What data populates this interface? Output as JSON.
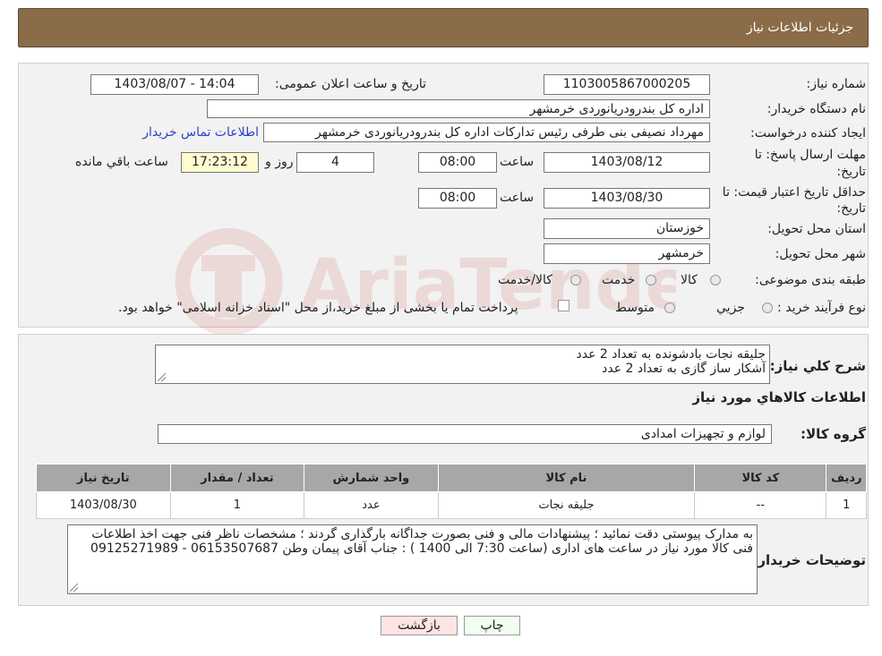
{
  "header": {
    "title": "جزئیات اطلاعات نیاز"
  },
  "form": {
    "need_number_label": "شماره نیاز:",
    "need_number": "1103005867000205",
    "announce_label": "تاریخ و ساعت اعلان عمومی:",
    "announce_value": "1403/08/07 - 14:04",
    "buyer_org_label": "نام دستگاه خریدار:",
    "buyer_org": "اداره کل بندرودریانوردی خرمشهر",
    "creator_label": "ایجاد کننده درخواست:",
    "creator": "مهرداد  نصیفی بنی طرفی رئیس تداركات اداره كل بندرودریانوردی خرمشهر",
    "contact_link": "اطلاعات تماس خریدار",
    "deadline_label_1": "مهلت ارسال پاسخ: تا",
    "deadline_label_2": "تاریخ:",
    "deadline_date": "1403/08/12",
    "time_label": "ساعت",
    "deadline_time": "08:00",
    "days_value": "4",
    "days_label": "روز و",
    "remaining_time": "17:23:12",
    "remaining_label": "ساعت باقي مانده",
    "validity_label_1": "حداقل تاریخ اعتبار قیمت: تا",
    "validity_label_2": "تاریخ:",
    "validity_date": "1403/08/30",
    "validity_time": "08:00",
    "province_label": "استان محل تحویل:",
    "province": "خوزستان",
    "city_label": "شهر محل تحویل:",
    "city": "خرمشهر",
    "category_label": "طبقه بندی موضوعی:",
    "category_options": [
      "کالا",
      "خدمت",
      "کالا/خدمت"
    ],
    "process_label": "نوع فرآیند خرید :",
    "process_options": [
      "جزیي",
      "متوسط"
    ],
    "payment_note": "پرداخت تمام یا بخشی از مبلغ خرید،از محل \"اسناد خزانه اسلامی\" خواهد بود."
  },
  "description": {
    "label": "شرح کلي نياز:",
    "lines": [
      "جلیقه نجات بادشونده به تعداد 2 عدد",
      "آشکار ساز گازی به تعداد 2 عدد"
    ]
  },
  "goods": {
    "section_title": "اطلاعات کالاهاي مورد نياز",
    "group_label": "گروه کالا:",
    "group_value": "لوازم و تجهیزات امدادی"
  },
  "table": {
    "headers": [
      "ردیف",
      "کد کالا",
      "نام کالا",
      "واحد شمارش",
      "تعداد / مقدار",
      "تاریخ نیاز"
    ],
    "rows": [
      [
        "1",
        "--",
        "جلیقه نجات",
        "عدد",
        "1",
        "1403/08/30"
      ]
    ]
  },
  "buyer_notes": {
    "label": "توضیحات خریدار:",
    "text": "به مدارک پیوستی دقت نمائید ؛ پیشنهادات مالی و فنی بصورت جداگانه بارگذاری گردند ؛ مشخصات ناظر فنی جهت اخذ اطلاعات فنی کالا مورد نیاز در ساعت های اداری (ساعت 7:30 الی 1400 ) : جناب آقای پیمان وطن  06153507687 - 09125271989"
  },
  "buttons": {
    "print": "چاپ",
    "back": "بازگشت"
  },
  "colors": {
    "header_bg": "#8b6c48",
    "table_header_bg": "#a7a7a7",
    "remaining_bg": "#fffbd0",
    "link": "#2a3fd0"
  },
  "watermark": {
    "text": "AriaTender.neT",
    "color": "#c0392b"
  }
}
